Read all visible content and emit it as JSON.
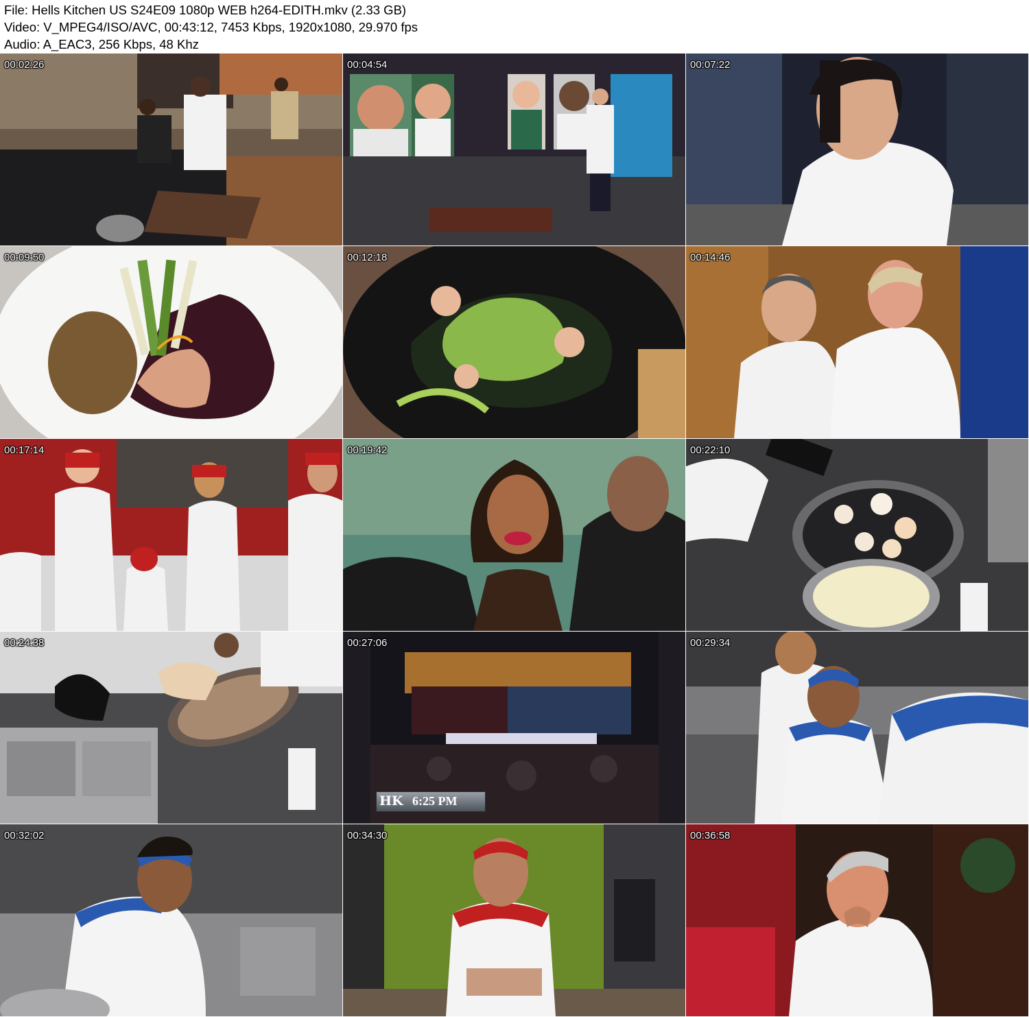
{
  "header": {
    "file_line": "File: Hells Kitchen US S24E09 1080p WEB h264-EDITH.mkv (2.33 GB)",
    "video_line": "Video: V_MPEG4/ISO/AVC, 00:43:12, 7453 Kbps, 1920x1080, 29.970 fps",
    "audio_line": "Audio: A_EAC3, 256 Kbps, 48 Khz"
  },
  "thumbnails": [
    {
      "timestamp": "00:02:26"
    },
    {
      "timestamp": "00:04:54"
    },
    {
      "timestamp": "00:07:22"
    },
    {
      "timestamp": "00:09:50"
    },
    {
      "timestamp": "00:12:18"
    },
    {
      "timestamp": "00:14:46"
    },
    {
      "timestamp": "00:17:14"
    },
    {
      "timestamp": "00:19:42"
    },
    {
      "timestamp": "00:22:10"
    },
    {
      "timestamp": "00:24:38"
    },
    {
      "timestamp": "00:27:06",
      "overlay_logo": "HK",
      "overlay_time": "6:25 PM"
    },
    {
      "timestamp": "00:29:34"
    },
    {
      "timestamp": "00:32:02"
    },
    {
      "timestamp": "00:34:30"
    },
    {
      "timestamp": "00:36:58"
    }
  ],
  "colors": {
    "page_background": "#ffffff",
    "header_text": "#000000",
    "timestamp_text": "#ffffff"
  }
}
